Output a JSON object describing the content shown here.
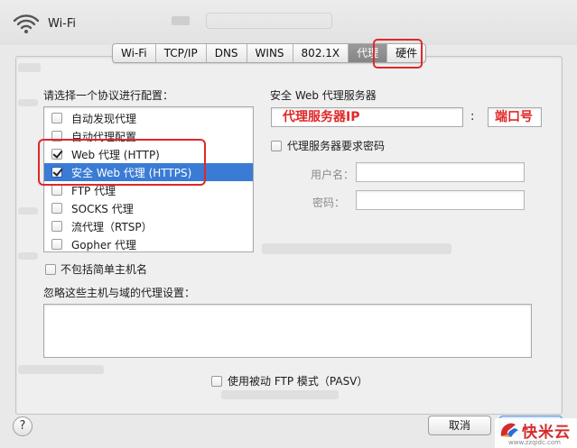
{
  "window": {
    "title": "Wi-Fi"
  },
  "tabs": [
    {
      "label": "Wi-Fi",
      "active": false
    },
    {
      "label": "TCP/IP",
      "active": false
    },
    {
      "label": "DNS",
      "active": false
    },
    {
      "label": "WINS",
      "active": false
    },
    {
      "label": "802.1X",
      "active": false
    },
    {
      "label": "代理",
      "active": true
    },
    {
      "label": "硬件",
      "active": false
    }
  ],
  "protocols": {
    "heading": "请选择一个协议进行配置：",
    "items": [
      {
        "label": "自动发现代理",
        "checked": false,
        "selected": false
      },
      {
        "label": "自动代理配置",
        "checked": false,
        "selected": false
      },
      {
        "label": "Web 代理 (HTTP)",
        "checked": true,
        "selected": false
      },
      {
        "label": "安全 Web 代理 (HTTPS)",
        "checked": true,
        "selected": true
      },
      {
        "label": "FTP 代理",
        "checked": false,
        "selected": false
      },
      {
        "label": "SOCKS 代理",
        "checked": false,
        "selected": false
      },
      {
        "label": "流代理（RTSP）",
        "checked": false,
        "selected": false
      },
      {
        "label": "Gopher 代理",
        "checked": false,
        "selected": false
      }
    ]
  },
  "exclude_simple": {
    "label": "不包括简单主机名",
    "checked": false
  },
  "bypass": {
    "heading": "忽略这些主机与域的代理设置：",
    "value": ""
  },
  "server": {
    "heading": "安全 Web 代理服务器",
    "host_annotation": "代理服务器IP",
    "colon": ":",
    "port_annotation": "端口号"
  },
  "requires_password": {
    "label": "代理服务器要求密码",
    "checked": false
  },
  "auth": {
    "username_label": "用户名：",
    "password_label": "密码：",
    "username_value": "",
    "password_value": ""
  },
  "pasv": {
    "label": "使用被动 FTP 模式（PASV）",
    "checked": false
  },
  "buttons": {
    "help": "?",
    "cancel": "取消"
  },
  "watermark": {
    "name": "快米云",
    "url": "www.zzqidc.com"
  },
  "colors": {
    "selection": "#3a7bd5",
    "annotation_red": "#e02828",
    "tab_active": "#8a8a8a"
  }
}
